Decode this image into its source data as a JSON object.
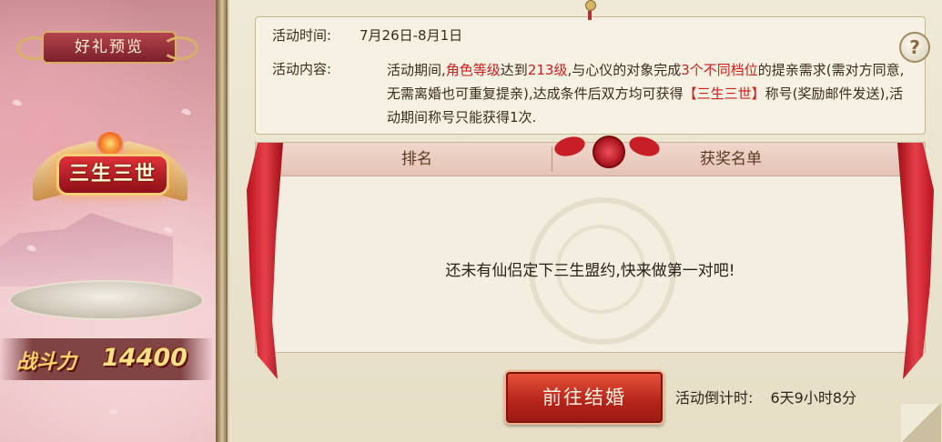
{
  "left_panel": {
    "preview_title": "好礼预览",
    "emblem_text": "三生三世",
    "power_label": "战斗力",
    "power_value": "14400"
  },
  "activity": {
    "time_label": "活动时间:",
    "time_value": "7月26日-8月1日",
    "content_label": "活动内容:",
    "content": {
      "p1": "活动期间,",
      "p2": "角色等级",
      "p3": "达到",
      "p4": "213级",
      "p5": ",与心仪的对象完成",
      "p6": "3个不同档位",
      "p7": "的提亲需求(需对方同意,无需离婚也可重复提亲),达成条件后双方均可获得",
      "p8": "【三生三世】",
      "p9": "称号(奖励邮件发送),活动期间称号只能获得1次."
    },
    "help_icon": "?"
  },
  "ranking": {
    "col_rank": "排名",
    "col_winners": "获奖名单",
    "empty_message": "还未有仙侣定下三生盟约,快来做第一对吧!"
  },
  "footer": {
    "go_button": "前往结婚",
    "countdown_label": "活动倒计时:",
    "countdown_value": "6天9小时8分"
  },
  "colors": {
    "accent_red": "#c8201d",
    "button_red": "#b3231a",
    "parchment": "#f6f1e3"
  }
}
